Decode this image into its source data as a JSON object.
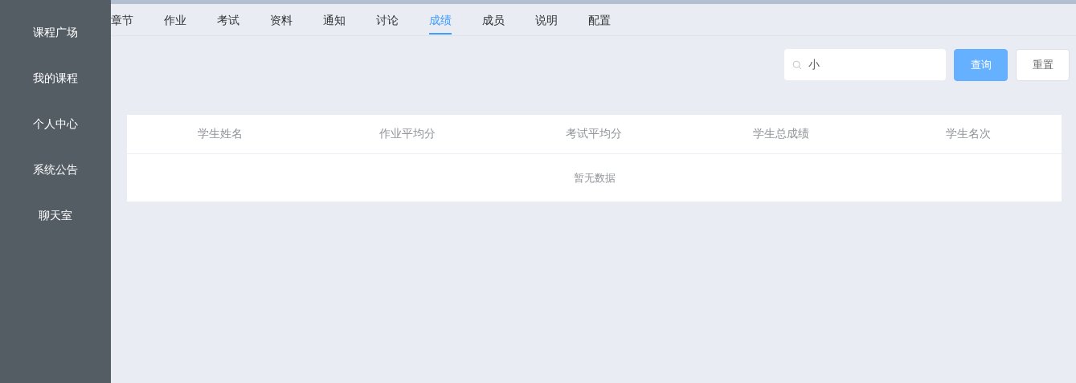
{
  "sidebar": {
    "items": [
      {
        "label": "课程广场"
      },
      {
        "label": "我的课程"
      },
      {
        "label": "个人中心"
      },
      {
        "label": "系统公告"
      },
      {
        "label": "聊天室"
      }
    ]
  },
  "tabs": [
    {
      "label": "章节",
      "selected": false
    },
    {
      "label": "作业",
      "selected": false
    },
    {
      "label": "考试",
      "selected": false
    },
    {
      "label": "资料",
      "selected": false
    },
    {
      "label": "通知",
      "selected": false
    },
    {
      "label": "讨论",
      "selected": false
    },
    {
      "label": "成绩",
      "selected": true
    },
    {
      "label": "成员",
      "selected": false
    },
    {
      "label": "说明",
      "selected": false
    },
    {
      "label": "配置",
      "selected": false
    }
  ],
  "search": {
    "value": "小"
  },
  "buttons": [
    {
      "label": "查询",
      "kind": "primary"
    },
    {
      "label": "重置",
      "kind": "default"
    }
  ],
  "table": {
    "columns": [
      "学生姓名",
      "作业平均分",
      "考试平均分",
      "学生总成绩",
      "学生名次"
    ],
    "empty_text": "暂无数据"
  }
}
